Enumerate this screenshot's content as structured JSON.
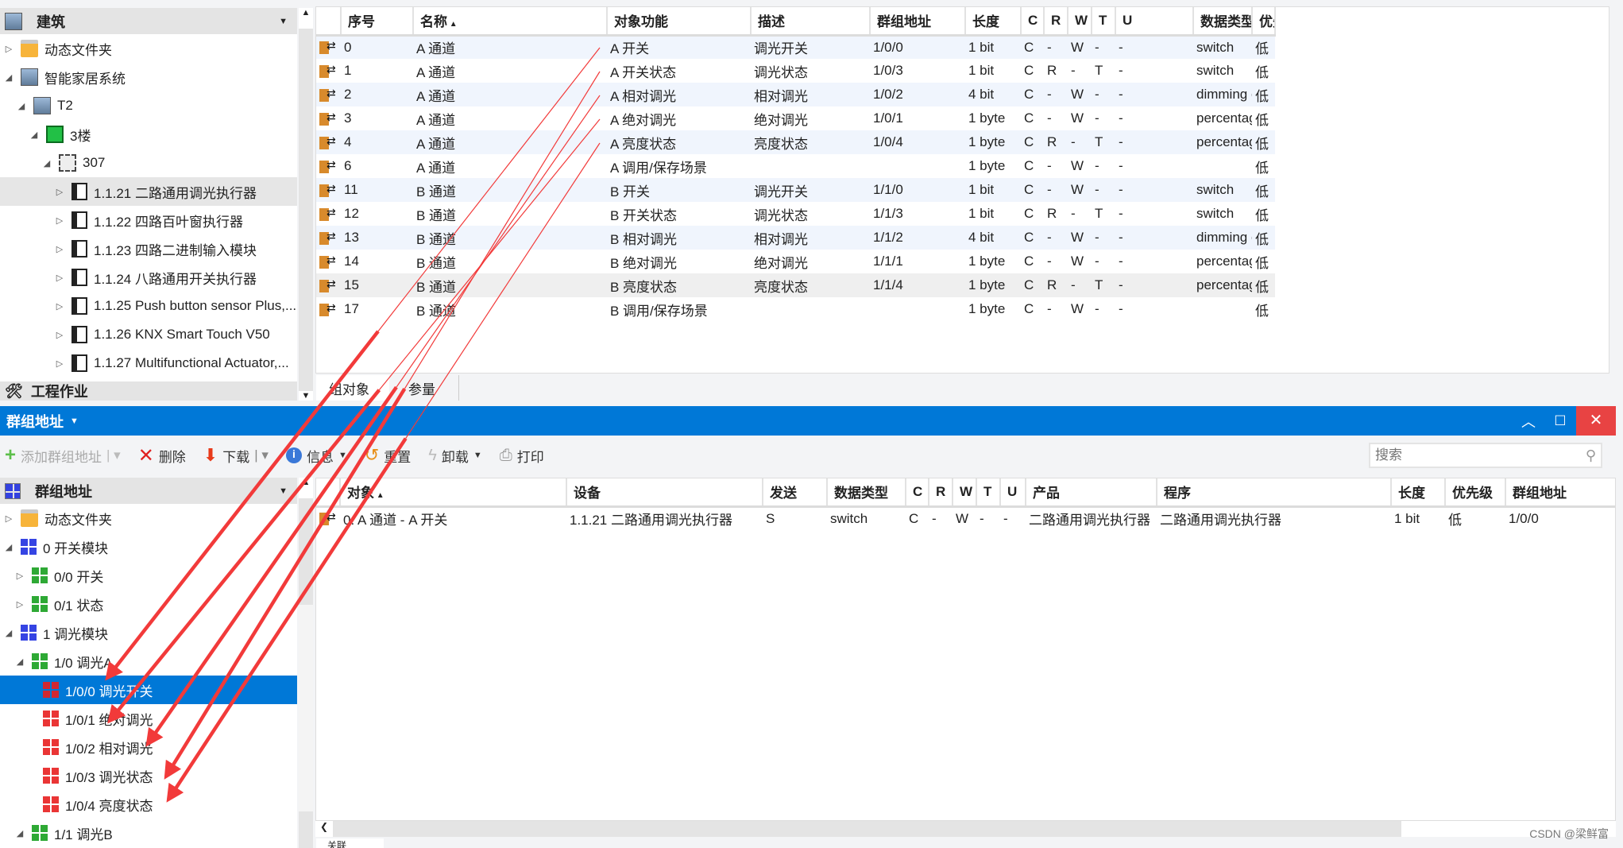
{
  "building_panel": {
    "title": "建筑",
    "tree": [
      {
        "label": "动态文件夹",
        "icon": "folder",
        "level": 0,
        "exp": "closed"
      },
      {
        "label": "智能家居系统",
        "icon": "bld",
        "level": 0,
        "exp": "open"
      },
      {
        "label": "T2",
        "icon": "bld",
        "level": 1,
        "exp": "open"
      },
      {
        "label": "3楼",
        "icon": "floor",
        "level": 2,
        "exp": "open"
      },
      {
        "label": "307",
        "icon": "room",
        "level": 3,
        "exp": "open"
      },
      {
        "label": "1.1.21 二路通用调光执行器",
        "icon": "dev",
        "level": 4,
        "exp": "closed",
        "selected": true
      },
      {
        "label": "1.1.22 四路百叶窗执行器",
        "icon": "dev",
        "level": 4,
        "exp": "closed"
      },
      {
        "label": "1.1.23 四路二进制输入模块",
        "icon": "dev",
        "level": 4,
        "exp": "closed"
      },
      {
        "label": "1.1.24 八路通用开关执行器",
        "icon": "dev",
        "level": 4,
        "exp": "closed"
      },
      {
        "label": "1.1.25 Push button sensor Plus,...",
        "icon": "dev",
        "level": 4,
        "exp": "closed"
      },
      {
        "label": "1.1.26 KNX Smart Touch V50",
        "icon": "dev",
        "level": 4,
        "exp": "closed"
      },
      {
        "label": "1.1.27 Multifunctional Actuator,...",
        "icon": "dev",
        "level": 4,
        "exp": "closed"
      }
    ],
    "footer": "工程作业"
  },
  "objects_table": {
    "headers": [
      "序号",
      "名称",
      "对象功能",
      "描述",
      "群组地址",
      "长度",
      "C",
      "R",
      "W",
      "T",
      "U",
      "数据类型",
      "优先级"
    ],
    "rows": [
      [
        "0",
        "A 通道",
        "A 开关",
        "调光开关",
        "1/0/0",
        "1 bit",
        "C",
        "-",
        "W",
        "-",
        "-",
        "switch",
        "低"
      ],
      [
        "1",
        "A 通道",
        "A 开关状态",
        "调光状态",
        "1/0/3",
        "1 bit",
        "C",
        "R",
        "-",
        "T",
        "-",
        "switch",
        "低"
      ],
      [
        "2",
        "A 通道",
        "A 相对调光",
        "相对调光",
        "1/0/2",
        "4 bit",
        "C",
        "-",
        "W",
        "-",
        "-",
        "dimming c...",
        "低"
      ],
      [
        "3",
        "A 通道",
        "A 绝对调光",
        "绝对调光",
        "1/0/1",
        "1 byte",
        "C",
        "-",
        "W",
        "-",
        "-",
        "percentag...",
        "低"
      ],
      [
        "4",
        "A 通道",
        "A 亮度状态",
        "亮度状态",
        "1/0/4",
        "1 byte",
        "C",
        "R",
        "-",
        "T",
        "-",
        "percentag...",
        "低"
      ],
      [
        "6",
        "A 通道",
        "A 调用/保存场景",
        "",
        "",
        "1 byte",
        "C",
        "-",
        "W",
        "-",
        "-",
        "",
        "低"
      ],
      [
        "11",
        "B 通道",
        "B 开关",
        "调光开关",
        "1/1/0",
        "1 bit",
        "C",
        "-",
        "W",
        "-",
        "-",
        "switch",
        "低"
      ],
      [
        "12",
        "B 通道",
        "B 开关状态",
        "调光状态",
        "1/1/3",
        "1 bit",
        "C",
        "R",
        "-",
        "T",
        "-",
        "switch",
        "低"
      ],
      [
        "13",
        "B 通道",
        "B 相对调光",
        "相对调光",
        "1/1/2",
        "4 bit",
        "C",
        "-",
        "W",
        "-",
        "-",
        "dimming c...",
        "低"
      ],
      [
        "14",
        "B 通道",
        "B 绝对调光",
        "绝对调光",
        "1/1/1",
        "1 byte",
        "C",
        "-",
        "W",
        "-",
        "-",
        "percentag...",
        "低"
      ],
      [
        "15",
        "B 通道",
        "B 亮度状态",
        "亮度状态",
        "1/1/4",
        "1 byte",
        "C",
        "R",
        "-",
        "T",
        "-",
        "percentag...",
        "低"
      ],
      [
        "17",
        "B 通道",
        "B 调用/保存场景",
        "",
        "",
        "1 byte",
        "C",
        "-",
        "W",
        "-",
        "-",
        "",
        "低"
      ]
    ],
    "tabs": [
      "组对象",
      "参量"
    ]
  },
  "group_window": {
    "title": "群组地址",
    "toolbar": {
      "add": "添加群组地址",
      "delete": "删除",
      "download": "下载",
      "info": "信息",
      "reset": "重置",
      "unload": "卸载",
      "print": "打印",
      "search_placeholder": "搜索"
    }
  },
  "group_panel": {
    "title": "群组地址",
    "tree": [
      {
        "label": "动态文件夹",
        "icon": "folder",
        "level": 0,
        "exp": "closed"
      },
      {
        "label": "0 开关模块",
        "icon": "ga-blue",
        "level": 0,
        "exp": "open"
      },
      {
        "label": "0/0 开关",
        "icon": "ga-green",
        "level": 1,
        "exp": "closed"
      },
      {
        "label": "0/1 状态",
        "icon": "ga-green",
        "level": 1,
        "exp": "closed"
      },
      {
        "label": "1 调光模块",
        "icon": "ga-blue",
        "level": 0,
        "exp": "open"
      },
      {
        "label": "1/0 调光A",
        "icon": "ga-green",
        "level": 1,
        "exp": "open"
      },
      {
        "label": "1/0/0 调光开关",
        "icon": "ga-red",
        "level": 2,
        "exp": "none",
        "selected": true
      },
      {
        "label": "1/0/1 绝对调光",
        "icon": "ga-red",
        "level": 2,
        "exp": "none"
      },
      {
        "label": "1/0/2 相对调光",
        "icon": "ga-red",
        "level": 2,
        "exp": "none"
      },
      {
        "label": "1/0/3 调光状态",
        "icon": "ga-red",
        "level": 2,
        "exp": "none"
      },
      {
        "label": "1/0/4 亮度状态",
        "icon": "ga-red",
        "level": 2,
        "exp": "none"
      },
      {
        "label": "1/1 调光B",
        "icon": "ga-green",
        "level": 1,
        "exp": "open"
      }
    ]
  },
  "links_table": {
    "headers": [
      "对象",
      "设备",
      "发送",
      "数据类型",
      "C",
      "R",
      "W",
      "T",
      "U",
      "产品",
      "程序",
      "长度",
      "优先级",
      "群组地址"
    ],
    "rows": [
      [
        "0: A 通道 - A 开关",
        "1.1.21 二路通用调光执行器",
        "S",
        "switch",
        "C",
        "-",
        "W",
        "-",
        "-",
        "二路通用调光执行器",
        "二路通用调光执行器",
        "1 bit",
        "低",
        "1/0/0"
      ]
    ],
    "tab": "关联"
  },
  "watermark": "CSDN @梁鲜富",
  "colors": {
    "accent": "#0078d7",
    "close": "#e81123",
    "arrow": "#f23a3a"
  }
}
